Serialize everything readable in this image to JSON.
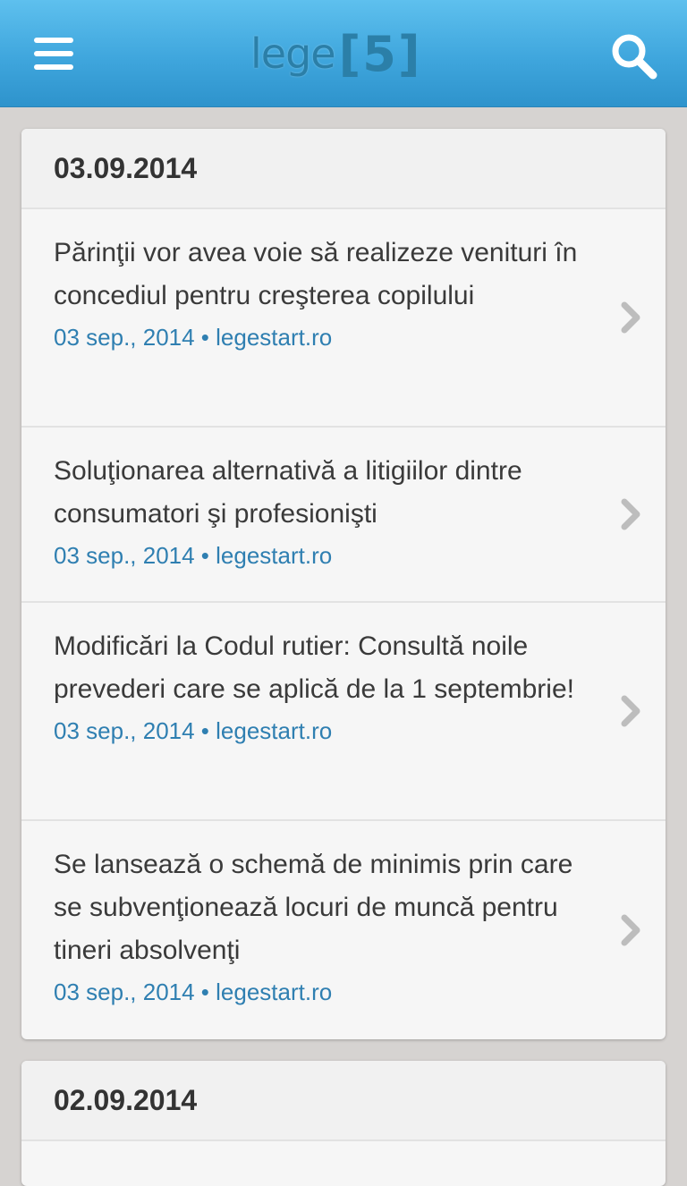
{
  "header": {
    "logo_word": "lege",
    "logo_number": "5",
    "menu_icon": "hamburger-menu-icon",
    "search_icon": "search-icon",
    "colors": {
      "bar_top": "#5ec0ee",
      "bar_bottom": "#2e93cc",
      "link": "#2f7fb1"
    }
  },
  "groups": [
    {
      "date": "03.09.2014",
      "items": [
        {
          "title": "Părinţii vor avea voie să realizeze venituri în concediul pentru creşterea copilului",
          "meta": "03 sep., 2014 • legestart.ro"
        },
        {
          "title": "Soluţionarea alternativă a litigiilor dintre consumatori şi profesionişti",
          "meta": "03 sep., 2014 • legestart.ro"
        },
        {
          "title": "Modificări la Codul rutier: Consultă noile prevederi care se aplică de la 1 septembrie!",
          "meta": "03 sep., 2014 • legestart.ro"
        },
        {
          "title": "Se lansează o schemă de minimis prin care se subvenţionează locuri de muncă pentru tineri absolvenţi",
          "meta": "03 sep., 2014 • legestart.ro"
        }
      ]
    },
    {
      "date": "02.09.2014",
      "items": []
    }
  ]
}
